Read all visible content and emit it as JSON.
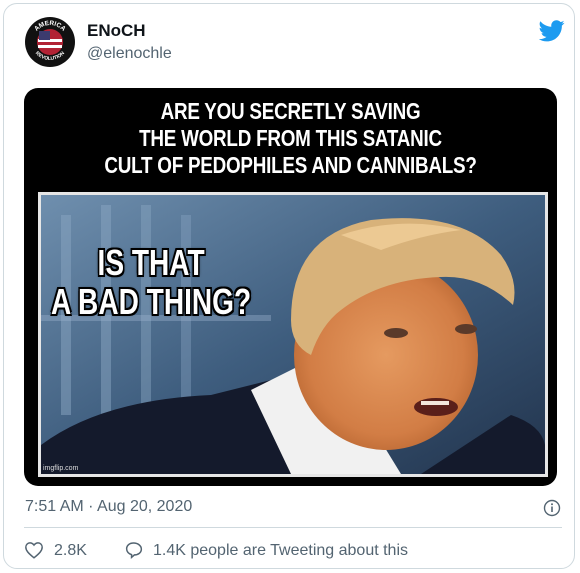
{
  "tweet": {
    "display_name": "ENoCH",
    "handle": "@elenochle",
    "timestamp": "7:51 AM · Aug 20, 2020",
    "likes": "2.8K",
    "people_tweeting": "1.4K people are Tweeting about this"
  },
  "avatar": {
    "arc_text_top": "AMERICA",
    "arc_text_bottom": "REVOLUTION"
  },
  "meme": {
    "headline_lines": [
      "ARE YOU SECRETLY SAVING",
      "THE WORLD FROM THIS SATANIC",
      "CULT OF PEDOPHILES AND CANNIBALS?"
    ],
    "caption_lines": [
      "IS THAT",
      "A BAD THING?"
    ],
    "watermark": "imgflip.com"
  },
  "colors": {
    "twitter_blue": "#1d9bf0",
    "secondary_text": "#536471",
    "border": "#cfd9de"
  },
  "icons": {
    "brand": "twitter-bird-icon",
    "info": "info-circle-icon",
    "like": "heart-icon",
    "reply": "speech-bubble-icon"
  }
}
